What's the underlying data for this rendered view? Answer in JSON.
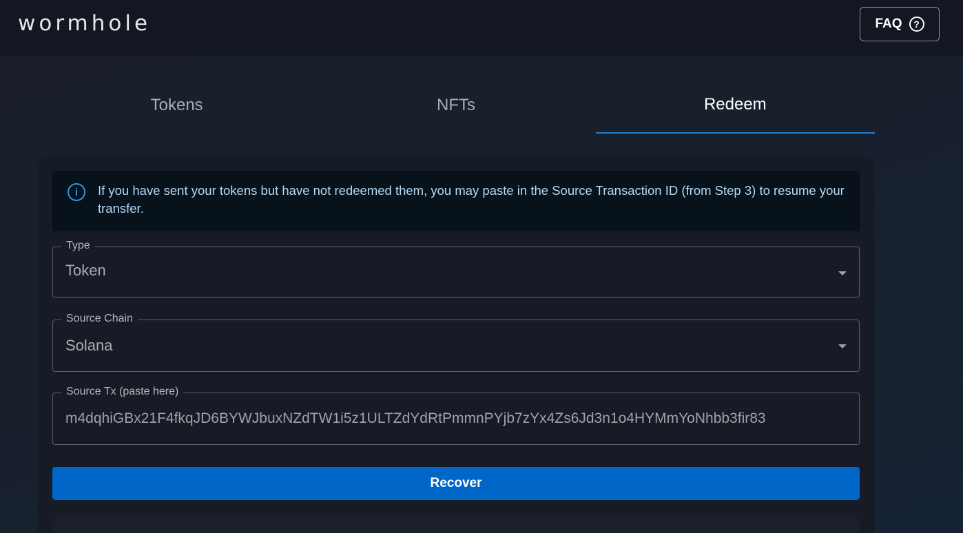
{
  "header": {
    "logo": "wormhole",
    "faq_label": "FAQ",
    "faq_icon": "?"
  },
  "tabs": [
    {
      "label": "Tokens",
      "active": false
    },
    {
      "label": "NFTs",
      "active": false
    },
    {
      "label": "Redeem",
      "active": true
    }
  ],
  "alert": {
    "icon": "i",
    "text": "If you have sent your tokens but have not redeemed them, you may paste in the Source Transaction ID (from Step 3) to resume your transfer."
  },
  "form": {
    "type": {
      "label": "Type",
      "value": "Token"
    },
    "source_chain": {
      "label": "Source Chain",
      "value": "Solana"
    },
    "source_tx": {
      "label": "Source Tx (paste here)",
      "value": "m4dqhiGBx21F4fkqJD6BYWJbuxNZdTW1i5z1ULTZdYdRtPmmnPYjb7zYx4Zs6Jd3n1o4HYMmYoNhbb3fir83"
    }
  },
  "recover_label": "Recover",
  "colors": {
    "accent": "#0066c7",
    "tab_underline": "#1d7fd6",
    "info": "#2a98e8"
  }
}
